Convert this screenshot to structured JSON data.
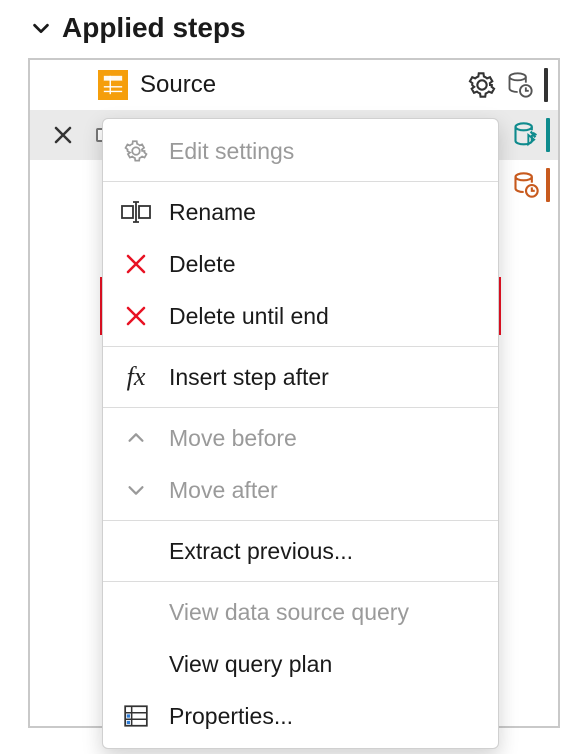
{
  "header": {
    "title": "Applied steps"
  },
  "steps": {
    "source": {
      "label": "Source"
    }
  },
  "menu": {
    "editSettings": "Edit settings",
    "rename": "Rename",
    "delete": "Delete",
    "deleteUntilEnd": "Delete until end",
    "insertStepAfter": "Insert step after",
    "moveBefore": "Move before",
    "moveAfter": "Move after",
    "extractPrevious": "Extract previous...",
    "viewDataSourceQuery": "View data source query",
    "viewQueryPlan": "View query plan",
    "properties": "Properties..."
  },
  "colors": {
    "accentOrange": "#f59e0b",
    "teal": "#0f8b8d",
    "darkOrange": "#c85a1e",
    "gray": "#5a5a5a",
    "red": "#e81123"
  }
}
